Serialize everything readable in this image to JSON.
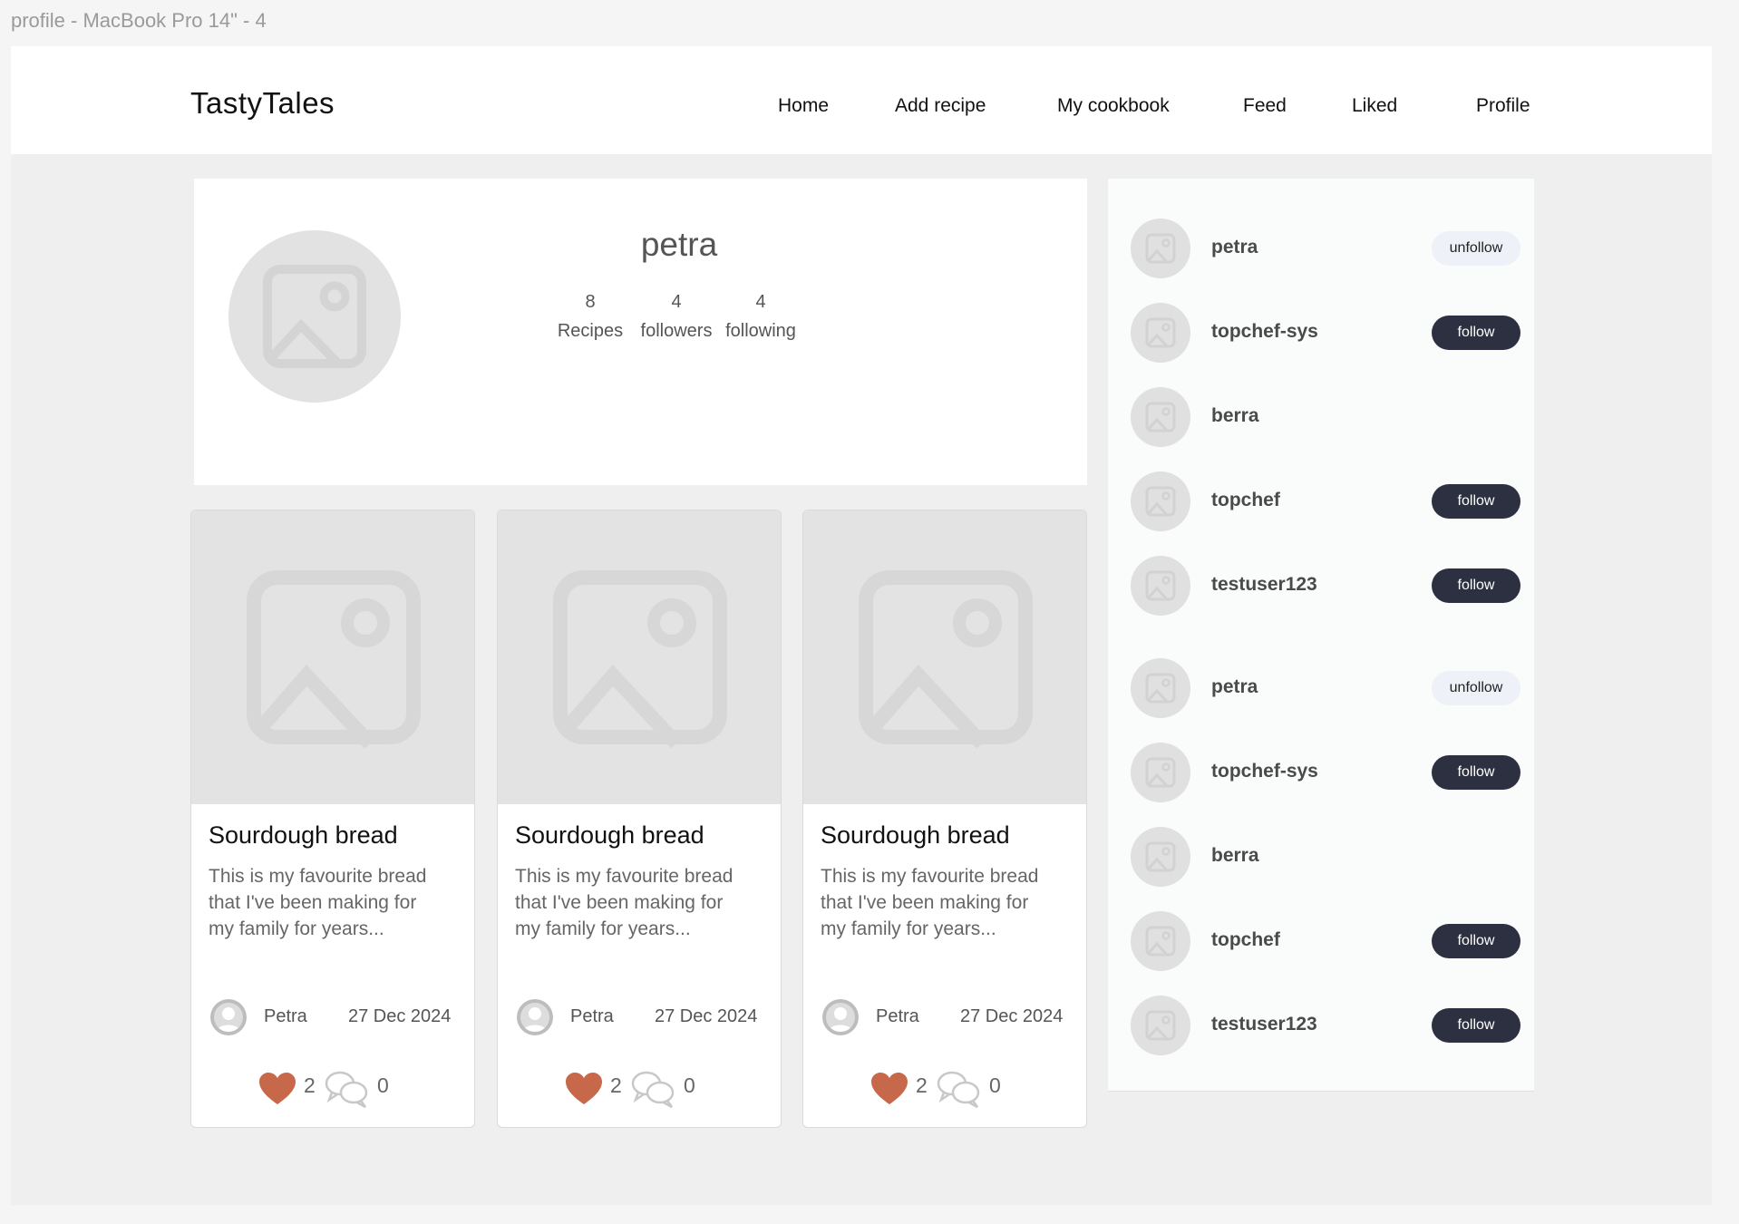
{
  "frame_title": "profile - MacBook Pro 14\" - 4",
  "brand": "TastyTales",
  "nav": [
    "Home",
    "Add recipe",
    "My cookbook",
    "Feed",
    "Liked",
    "Profile"
  ],
  "profile": {
    "username": "petra",
    "stats": [
      {
        "value": "8",
        "label": "Recipes"
      },
      {
        "value": "4",
        "label": "followers"
      },
      {
        "value": "4",
        "label": "following"
      }
    ]
  },
  "recipes": [
    {
      "title": "Sourdough bread",
      "description": "This is my favourite bread\n that I've been making for\nmy family for years...",
      "author": "Petra",
      "date": "27 Dec 2024",
      "likes": "2",
      "comments": "0"
    },
    {
      "title": "Sourdough bread",
      "description": "This is my favourite bread\n that I've been making for\nmy family for years...",
      "author": "Petra",
      "date": "27 Dec 2024",
      "likes": "2",
      "comments": "0"
    },
    {
      "title": "Sourdough bread",
      "description": "This is my favourite bread\n that I've been making for\nmy family for years...",
      "author": "Petra",
      "date": "27 Dec 2024",
      "likes": "2",
      "comments": "0"
    }
  ],
  "users": [
    {
      "name": "petra",
      "action": "unfollow"
    },
    {
      "name": "topchef-sys",
      "action": "follow"
    },
    {
      "name": "berra",
      "action": ""
    },
    {
      "name": "topchef",
      "action": "follow"
    },
    {
      "name": "testuser123",
      "action": "follow"
    },
    {
      "name": "petra",
      "action": "unfollow"
    },
    {
      "name": "topchef-sys",
      "action": "follow"
    },
    {
      "name": "berra",
      "action": ""
    },
    {
      "name": "topchef",
      "action": "follow"
    },
    {
      "name": "testuser123",
      "action": "follow"
    }
  ],
  "colors": {
    "heart": "#c8684a",
    "follow_button": "#2c3040",
    "unfollow_button": "#eef1f7"
  },
  "icons": {
    "like": "heart-icon",
    "comment": "comment-icon",
    "placeholder": "image-placeholder-icon",
    "author": "user-avatar-icon"
  }
}
